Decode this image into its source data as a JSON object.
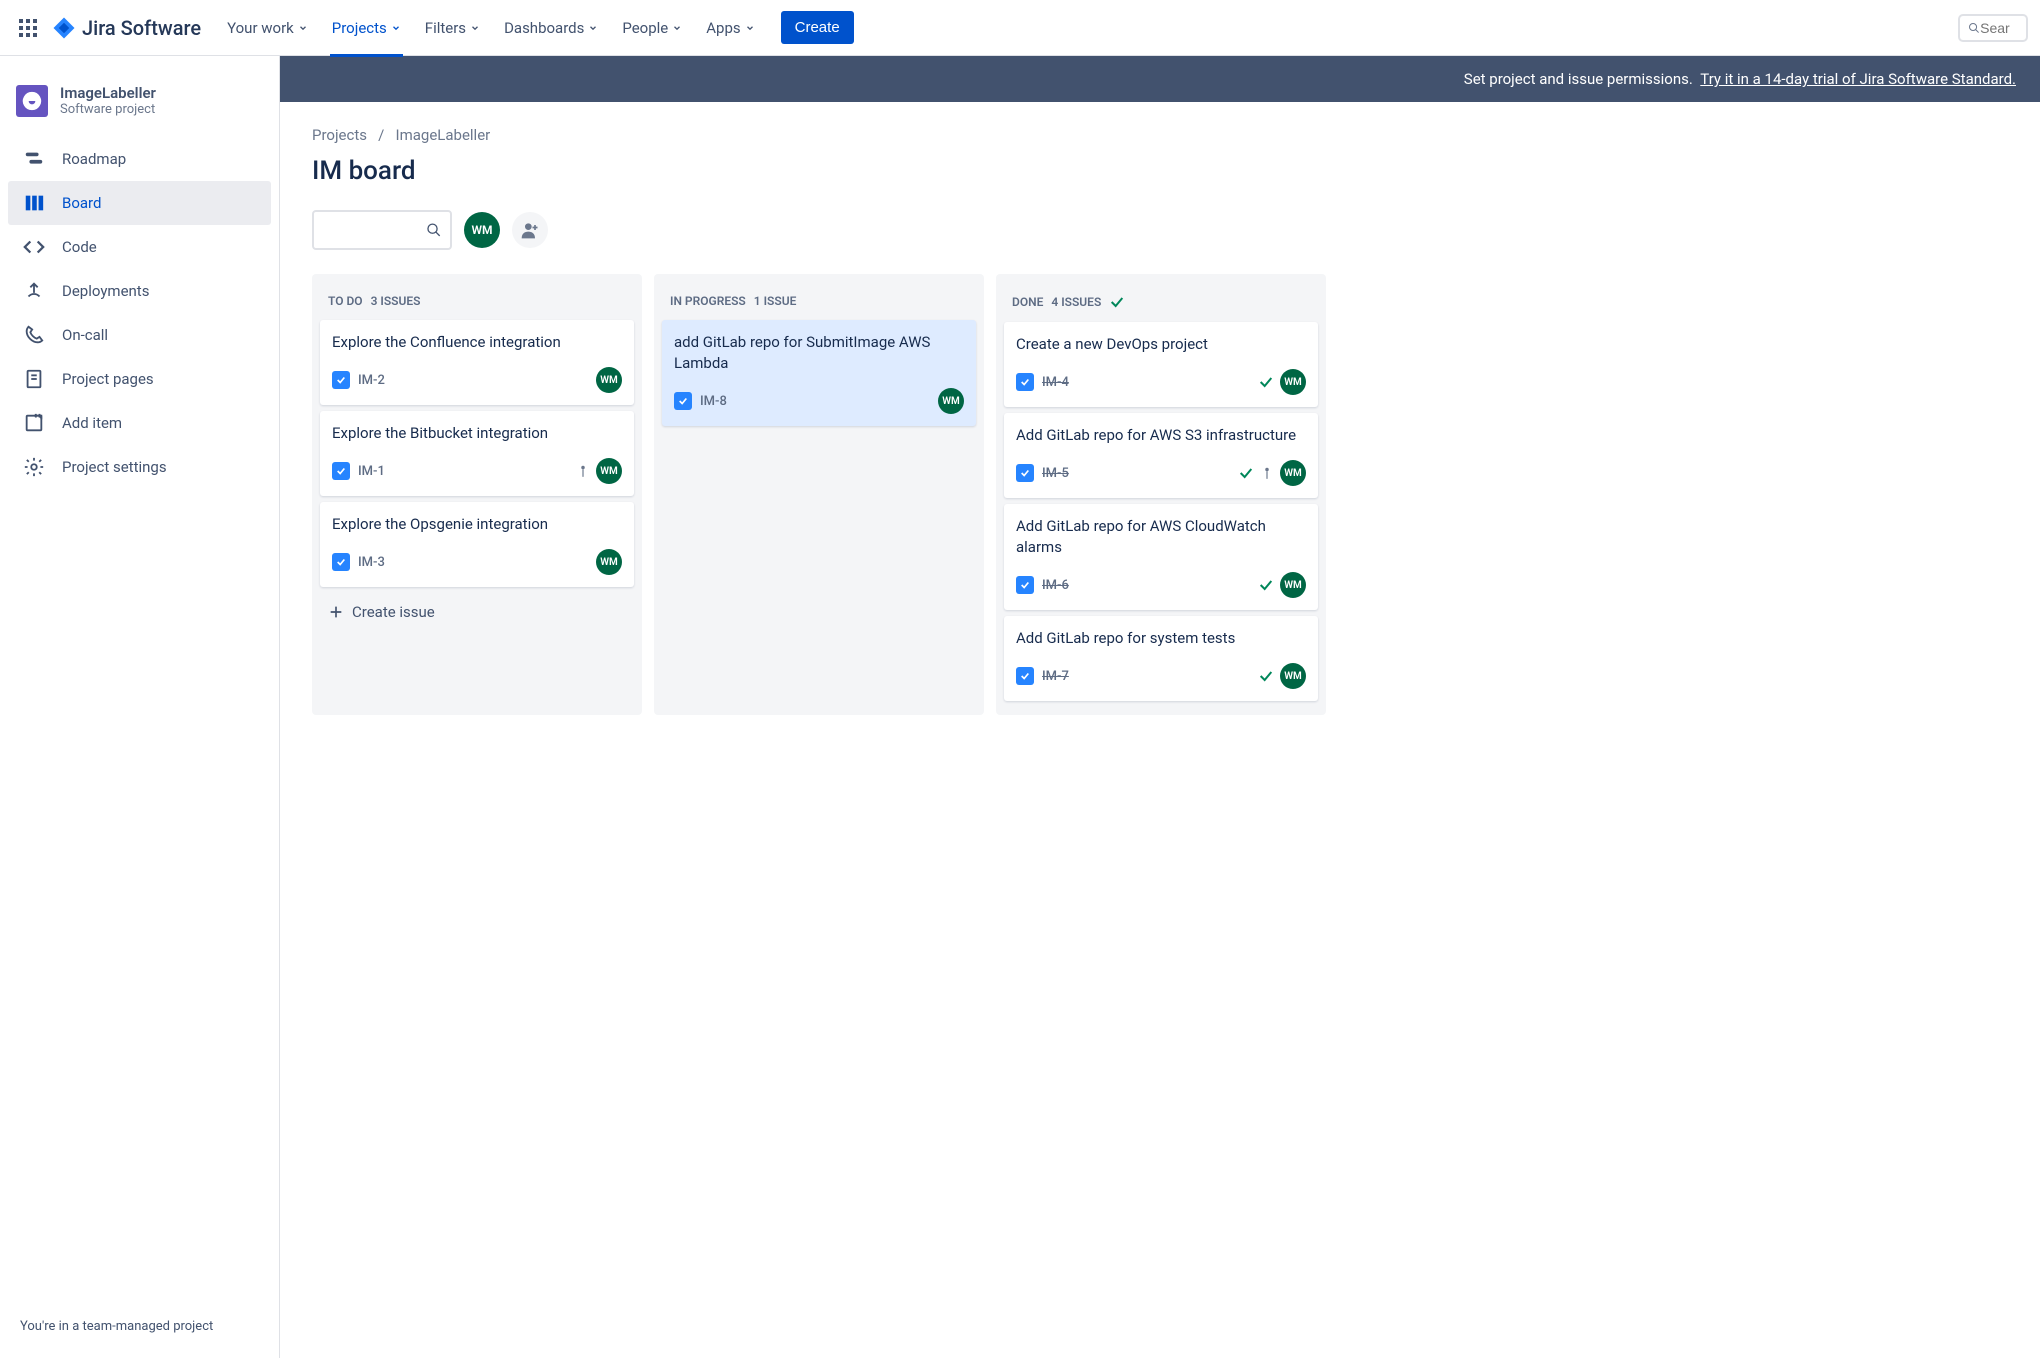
{
  "topnav": {
    "logo_text": "Jira Software",
    "items": [
      {
        "label": "Your work"
      },
      {
        "label": "Projects",
        "active": true
      },
      {
        "label": "Filters"
      },
      {
        "label": "Dashboards"
      },
      {
        "label": "People"
      },
      {
        "label": "Apps"
      }
    ],
    "create_label": "Create",
    "search_placeholder": "Sear"
  },
  "sidebar": {
    "project_name": "ImageLabeller",
    "project_type": "Software project",
    "items": [
      {
        "label": "Roadmap",
        "icon": "roadmap"
      },
      {
        "label": "Board",
        "icon": "board",
        "active": true
      },
      {
        "label": "Code",
        "icon": "code"
      },
      {
        "label": "Deployments",
        "icon": "deployments"
      },
      {
        "label": "On-call",
        "icon": "oncall"
      },
      {
        "label": "Project pages",
        "icon": "pages"
      },
      {
        "label": "Add item",
        "icon": "additem"
      },
      {
        "label": "Project settings",
        "icon": "settings"
      }
    ],
    "footer": "You're in a team-managed project"
  },
  "banner": {
    "text": "Set project and issue permissions.",
    "link_text": "Try it in a 14-day trial of Jira Software Standard."
  },
  "breadcrumb": {
    "root": "Projects",
    "current": "ImageLabeller"
  },
  "page_title": "IM board",
  "toolbar": {
    "avatar_initials": "WM"
  },
  "columns": [
    {
      "name": "To Do",
      "count_text": "3 issues",
      "show_check": false,
      "cards": [
        {
          "title": "Explore the Confluence integration",
          "key": "IM-2",
          "assignee": "WM",
          "done": false,
          "priority": false
        },
        {
          "title": "Explore the Bitbucket integration",
          "key": "IM-1",
          "assignee": "WM",
          "done": false,
          "priority": true
        },
        {
          "title": "Explore the Opsgenie integration",
          "key": "IM-3",
          "assignee": "WM",
          "done": false,
          "priority": false
        }
      ],
      "create_label": "Create issue"
    },
    {
      "name": "In Progress",
      "count_text": "1 issue",
      "show_check": false,
      "cards": [
        {
          "title": "add GitLab repo for SubmitImage AWS Lambda",
          "key": "IM-8",
          "assignee": "WM",
          "done": false,
          "priority": false,
          "selected": true
        }
      ]
    },
    {
      "name": "Done",
      "count_text": "4 issues",
      "show_check": true,
      "cards": [
        {
          "title": "Create a new DevOps project",
          "key": "IM-4",
          "assignee": "WM",
          "done": true,
          "priority": false
        },
        {
          "title": "Add GitLab repo for AWS S3 infrastructure",
          "key": "IM-5",
          "assignee": "WM",
          "done": true,
          "priority": true
        },
        {
          "title": "Add GitLab repo for AWS CloudWatch alarms",
          "key": "IM-6",
          "assignee": "WM",
          "done": true,
          "priority": false
        },
        {
          "title": "Add GitLab repo for system tests",
          "key": "IM-7",
          "assignee": "WM",
          "done": true,
          "priority": false
        }
      ]
    }
  ]
}
